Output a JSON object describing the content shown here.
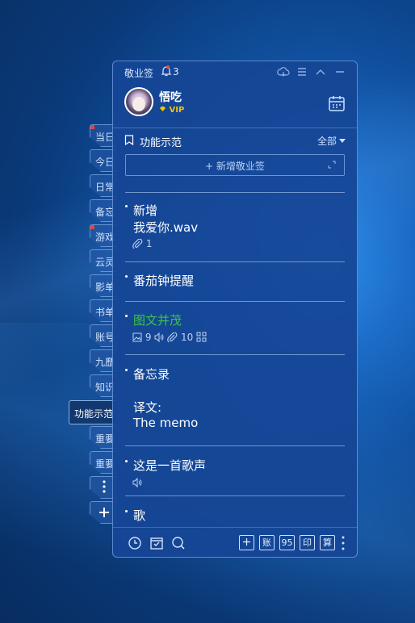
{
  "app": {
    "title": "敬业签",
    "notification_count": "3"
  },
  "user": {
    "name": "悟吃",
    "badge": "VIP"
  },
  "section": {
    "title": "功能示范",
    "filter": "全部"
  },
  "new_note": {
    "label": "+ 新增敬业签"
  },
  "side_tabs": [
    "当日",
    "今日",
    "日常",
    "备忘",
    "游戏",
    "云灵",
    "影单",
    "书单",
    "账号",
    "九歷",
    "知识",
    "功能示范",
    "重要",
    "重要"
  ],
  "notes": [
    {
      "lines": [
        "新增",
        "我爱你.wav"
      ],
      "meta": {
        "attachments": "1"
      }
    },
    {
      "lines": [
        "番茄钟提醒"
      ]
    },
    {
      "lines": [
        "图文并茂"
      ],
      "meta": {
        "images": "9",
        "attachments": "10"
      }
    },
    {
      "lines": [
        "备忘录",
        "",
        "译文:",
        "The memo"
      ]
    },
    {
      "lines": [
        "这是一首歌声"
      ]
    },
    {
      "lines": [
        "歌"
      ]
    }
  ],
  "bottom_bar": {
    "btn_account": "账",
    "btn_95": "95",
    "btn_print": "印",
    "btn_calc": "算"
  },
  "colors": {
    "panel": "#16469a",
    "accent_green": "#3cc24a",
    "vip": "#f2c400",
    "alert": "#ff4a3a"
  }
}
